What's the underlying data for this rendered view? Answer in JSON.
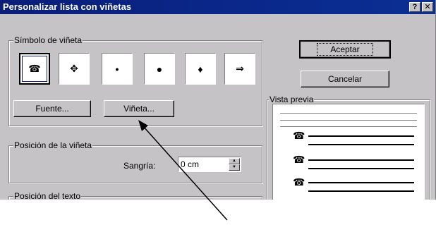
{
  "window": {
    "title": "Personalizar lista con viñetas",
    "help_glyph": "?",
    "close_glyph": "✕"
  },
  "bullet_symbol": {
    "label": "Símbolo de viñeta",
    "options": [
      "☎",
      "✥",
      "•",
      "●",
      "♦",
      "⇒"
    ],
    "selected_index": 0
  },
  "buttons": {
    "font": "Fuente...",
    "bullet": "Viñeta...",
    "accept": "Aceptar",
    "cancel": "Cancelar"
  },
  "bullet_position": {
    "label": "Posición de la viñeta",
    "indent_label": "Sangría:",
    "indent_value": "0 cm"
  },
  "text_position": {
    "label": "Posición del texto"
  },
  "preview": {
    "label": "Vista previa",
    "bullet_glyph": "☎"
  }
}
